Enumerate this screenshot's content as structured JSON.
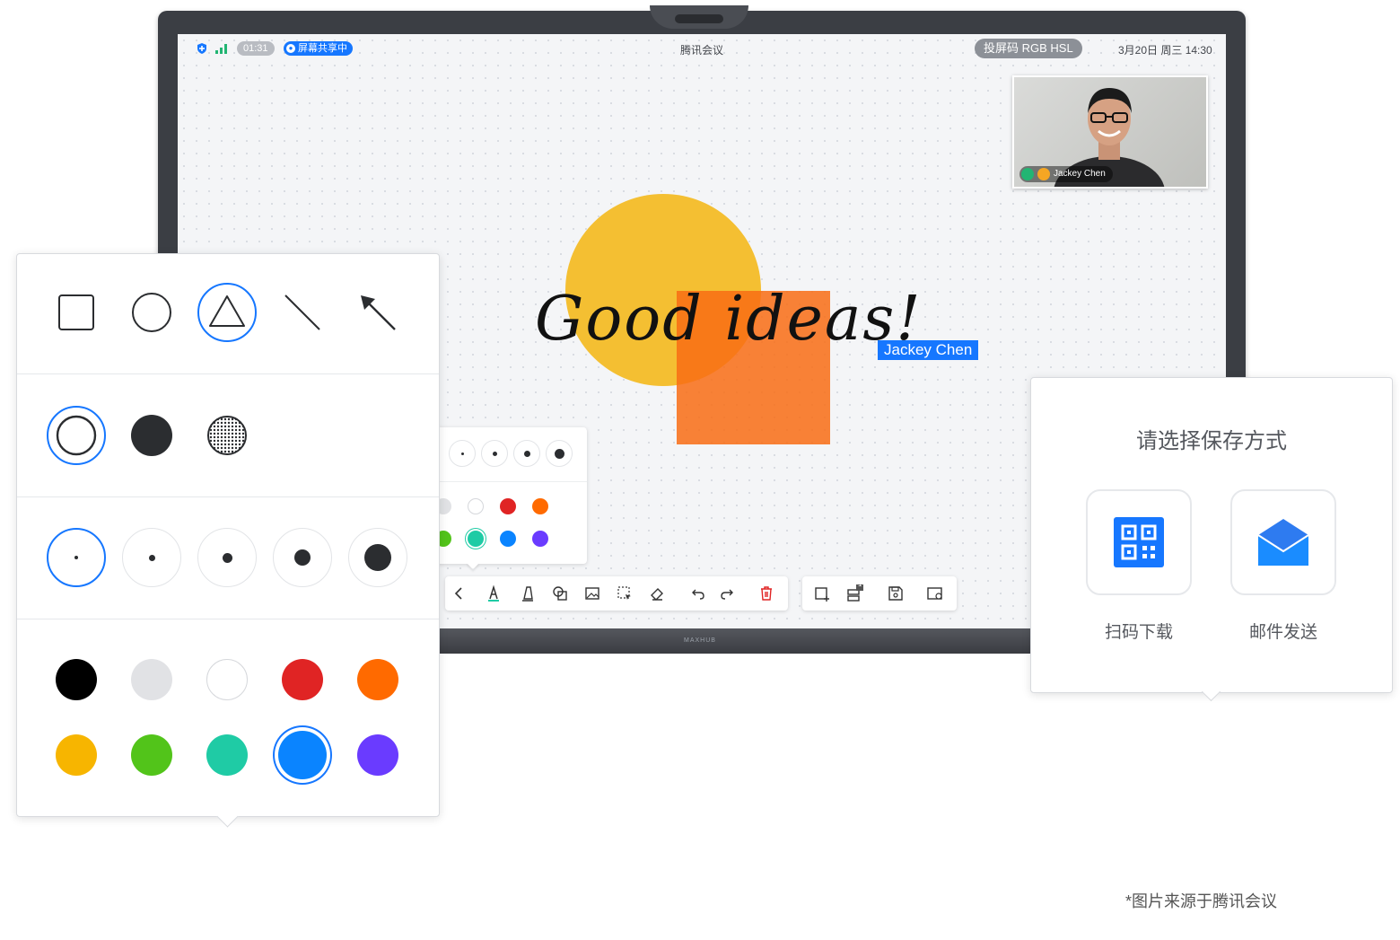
{
  "status_bar": {
    "timer": "01:31",
    "sharing_label": "屏幕共享中",
    "app_title": "腾讯会议",
    "cast_code": "投屏码 RGB HSL",
    "datetime": "3月20日 周三 14:30"
  },
  "video": {
    "participant_name": "Jackey Chen"
  },
  "canvas": {
    "handwriting": "Good ideas!",
    "cursor_tag": "Jackey Chen"
  },
  "monitor": {
    "brand": "MAXHUB"
  },
  "shapes_panel": {
    "shapes": [
      "rectangle-icon",
      "circle-icon",
      "triangle-icon",
      "line-icon",
      "arrow-icon"
    ],
    "selected_shape": "triangle-icon",
    "fill_styles": [
      "outline",
      "solid",
      "pattern"
    ],
    "selected_fill": "outline",
    "sizes": [
      1,
      2,
      3,
      4,
      5
    ],
    "selected_size": 1,
    "colors_row1": [
      "#000000",
      "#e1e2e5",
      "#ffffff",
      "#e02424",
      "#ff6a00"
    ],
    "colors_row2": [
      "#f7b500",
      "#52c41a",
      "#1fcba5",
      "#0a84ff",
      "#6a3bff"
    ],
    "selected_color": "#0a84ff"
  },
  "mini_popover": {
    "colors_row1": [
      "#e1e2e5",
      "#ffffff",
      "#e02424",
      "#ff6a00"
    ],
    "colors_row2": [
      "#52c41a",
      "#1fcba5",
      "#0a84ff",
      "#6a3bff"
    ],
    "selected_color": "#1fcba5"
  },
  "toolbar": {
    "tools": [
      "back-icon",
      "pen-icon",
      "highlighter-icon",
      "shape-icon",
      "image-icon",
      "select-icon",
      "eraser-icon",
      "undo-icon",
      "redo-icon",
      "delete-icon"
    ],
    "tools2": [
      "new-page-icon",
      "pages-icon",
      "save-icon",
      "settings-icon"
    ],
    "page_badge": "1"
  },
  "save_panel": {
    "title": "请选择保存方式",
    "option_qr": "扫码下载",
    "option_mail": "邮件发送"
  },
  "source_note": "*图片来源于腾讯会议"
}
